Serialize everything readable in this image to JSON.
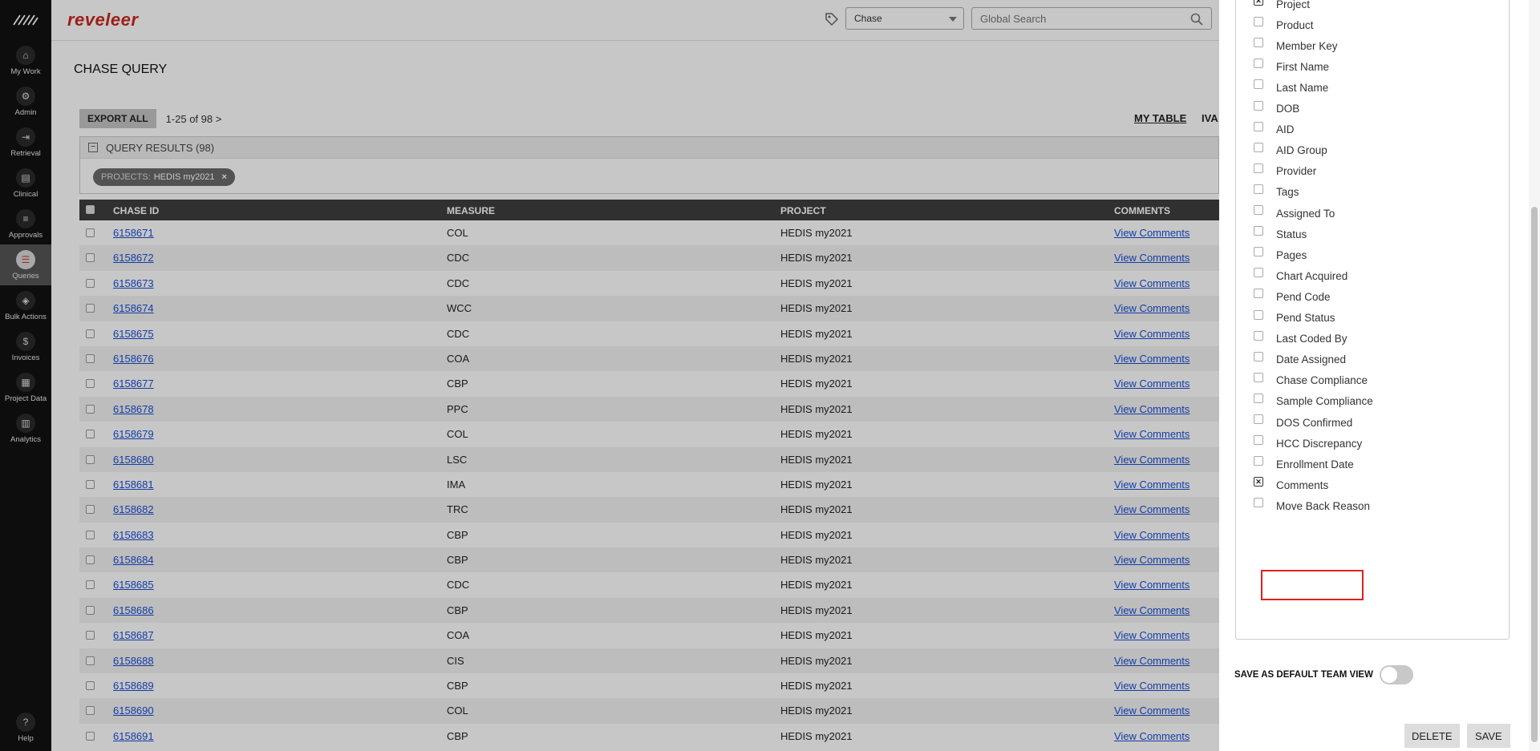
{
  "nav": {
    "items": [
      {
        "label": "My Work",
        "icon": "house-icon",
        "glyph": "⌂"
      },
      {
        "label": "Admin",
        "icon": "gear-icon",
        "glyph": "⚙"
      },
      {
        "label": "Retrieval",
        "icon": "arrow-in-icon",
        "glyph": "⇥"
      },
      {
        "label": "Clinical",
        "icon": "clipboard-icon",
        "glyph": "▤"
      },
      {
        "label": "Approvals",
        "icon": "list-check-icon",
        "glyph": "≡"
      },
      {
        "label": "Queries",
        "icon": "query-icon",
        "glyph": "☰"
      },
      {
        "label": "Bulk Actions",
        "icon": "layers-icon",
        "glyph": "◈"
      },
      {
        "label": "Invoices",
        "icon": "dollar-icon",
        "glyph": "$"
      },
      {
        "label": "Project Data",
        "icon": "grid-icon",
        "glyph": "▦"
      },
      {
        "label": "Analytics",
        "icon": "bar-chart-icon",
        "glyph": "▥"
      }
    ],
    "help": {
      "label": "Help",
      "glyph": "?"
    }
  },
  "header": {
    "brand": "reveleer",
    "chase_select": "Chase",
    "search_placeholder": "Global Search"
  },
  "page": {
    "title": "CHASE QUERY",
    "export_label": "EXPORT ALL",
    "pager": "1-25  of  98 >",
    "my_table": "MY TABLE",
    "iva": "IVA",
    "results_title": "QUERY RESULTS (98)",
    "chip_label": "PROJECTS:",
    "chip_value": "HEDIS my2021",
    "chip_close": "×"
  },
  "table": {
    "columns": [
      "CHASE ID",
      "MEASURE",
      "PROJECT",
      "COMMENTS"
    ],
    "rows": [
      {
        "id": "6158671",
        "measure": "COL",
        "project": "HEDIS my2021",
        "comments": "View Comments"
      },
      {
        "id": "6158672",
        "measure": "CDC",
        "project": "HEDIS my2021",
        "comments": "View Comments"
      },
      {
        "id": "6158673",
        "measure": "CDC",
        "project": "HEDIS my2021",
        "comments": "View Comments"
      },
      {
        "id": "6158674",
        "measure": "WCC",
        "project": "HEDIS my2021",
        "comments": "View Comments"
      },
      {
        "id": "6158675",
        "measure": "CDC",
        "project": "HEDIS my2021",
        "comments": "View Comments"
      },
      {
        "id": "6158676",
        "measure": "COA",
        "project": "HEDIS my2021",
        "comments": "View Comments"
      },
      {
        "id": "6158677",
        "measure": "CBP",
        "project": "HEDIS my2021",
        "comments": "View Comments"
      },
      {
        "id": "6158678",
        "measure": "PPC",
        "project": "HEDIS my2021",
        "comments": "View Comments"
      },
      {
        "id": "6158679",
        "measure": "COL",
        "project": "HEDIS my2021",
        "comments": "View Comments"
      },
      {
        "id": "6158680",
        "measure": "LSC",
        "project": "HEDIS my2021",
        "comments": "View Comments"
      },
      {
        "id": "6158681",
        "measure": "IMA",
        "project": "HEDIS my2021",
        "comments": "View Comments"
      },
      {
        "id": "6158682",
        "measure": "TRC",
        "project": "HEDIS my2021",
        "comments": "View Comments"
      },
      {
        "id": "6158683",
        "measure": "CBP",
        "project": "HEDIS my2021",
        "comments": "View Comments"
      },
      {
        "id": "6158684",
        "measure": "CBP",
        "project": "HEDIS my2021",
        "comments": "View Comments"
      },
      {
        "id": "6158685",
        "measure": "CDC",
        "project": "HEDIS my2021",
        "comments": "View Comments"
      },
      {
        "id": "6158686",
        "measure": "CBP",
        "project": "HEDIS my2021",
        "comments": "View Comments"
      },
      {
        "id": "6158687",
        "measure": "COA",
        "project": "HEDIS my2021",
        "comments": "View Comments"
      },
      {
        "id": "6158688",
        "measure": "CIS",
        "project": "HEDIS my2021",
        "comments": "View Comments"
      },
      {
        "id": "6158689",
        "measure": "CBP",
        "project": "HEDIS my2021",
        "comments": "View Comments"
      },
      {
        "id": "6158690",
        "measure": "COL",
        "project": "HEDIS my2021",
        "comments": "View Comments"
      },
      {
        "id": "6158691",
        "measure": "CBP",
        "project": "HEDIS my2021",
        "comments": "View Comments"
      }
    ]
  },
  "column_panel": {
    "items": [
      {
        "label": "Project",
        "checked": true
      },
      {
        "label": "Product",
        "checked": false
      },
      {
        "label": "Member Key",
        "checked": false
      },
      {
        "label": "First Name",
        "checked": false
      },
      {
        "label": "Last Name",
        "checked": false
      },
      {
        "label": "DOB",
        "checked": false
      },
      {
        "label": "AID",
        "checked": false
      },
      {
        "label": "AID Group",
        "checked": false
      },
      {
        "label": "Provider",
        "checked": false
      },
      {
        "label": "Tags",
        "checked": false
      },
      {
        "label": "Assigned To",
        "checked": false
      },
      {
        "label": "Status",
        "checked": false
      },
      {
        "label": "Pages",
        "checked": false
      },
      {
        "label": "Chart Acquired",
        "checked": false
      },
      {
        "label": "Pend Code",
        "checked": false
      },
      {
        "label": "Pend Status",
        "checked": false
      },
      {
        "label": "Last Coded By",
        "checked": false
      },
      {
        "label": "Date Assigned",
        "checked": false
      },
      {
        "label": "Chase Compliance",
        "checked": false
      },
      {
        "label": "Sample Compliance",
        "checked": false
      },
      {
        "label": "DOS Confirmed",
        "checked": false
      },
      {
        "label": "HCC Discrepancy",
        "checked": false
      },
      {
        "label": "Enrollment Date",
        "checked": false
      },
      {
        "label": "Comments",
        "checked": true
      },
      {
        "label": "Move Back Reason",
        "checked": false
      }
    ],
    "default_view_label": "SAVE AS DEFAULT TEAM VIEW",
    "default_view_on": false,
    "delete_label": "DELETE",
    "save_label": "SAVE"
  },
  "colors": {
    "brand": "#c8281e",
    "link": "#1a4fd6",
    "highlight": "#e02020",
    "header_bg": "#3e3e3e"
  }
}
